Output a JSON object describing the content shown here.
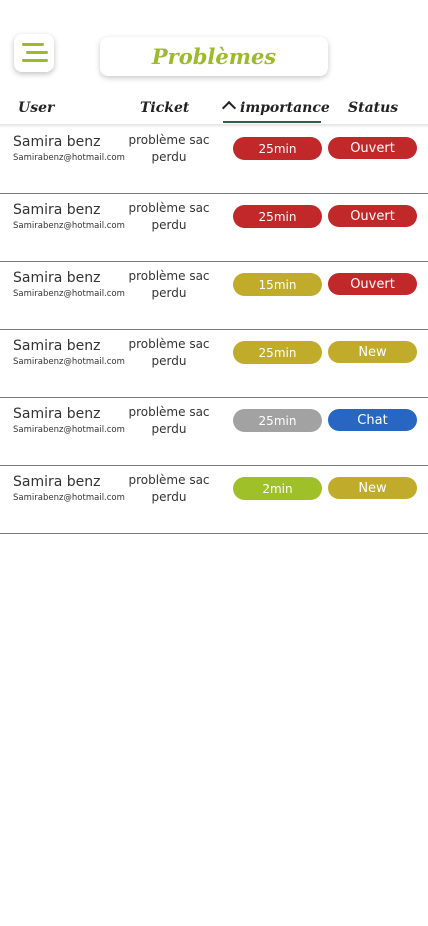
{
  "header": {
    "title": "Problèmes"
  },
  "columns": {
    "user": "User",
    "ticket": "Ticket",
    "importance": "importance",
    "status": "Status"
  },
  "colors": {
    "accent": "#9cbb2a",
    "red": "#c0282a",
    "olive": "#c0ac2a",
    "gray": "#a2a2a2",
    "blue": "#2767c3",
    "lime": "#a0c02a"
  },
  "rows": [
    {
      "name": "Samira benz",
      "email": "Samirabenz@hotmail.com",
      "ticket": "problème sac perdu",
      "importance": "25min",
      "importance_color": "#c0282a",
      "status": "Ouvert",
      "status_color": "#c0282a"
    },
    {
      "name": "Samira benz",
      "email": "Samirabenz@hotmail.com",
      "ticket": "problème sac perdu",
      "importance": "25min",
      "importance_color": "#c0282a",
      "status": "Ouvert",
      "status_color": "#c0282a"
    },
    {
      "name": "Samira benz",
      "email": "Samirabenz@hotmail.com",
      "ticket": "problème sac perdu",
      "importance": "15min",
      "importance_color": "#c0ac2a",
      "status": "Ouvert",
      "status_color": "#c0282a"
    },
    {
      "name": "Samira benz",
      "email": "Samirabenz@hotmail.com",
      "ticket": "problème sac perdu",
      "importance": "25min",
      "importance_color": "#c0ac2a",
      "status": "New",
      "status_color": "#c0ac2a"
    },
    {
      "name": "Samira benz",
      "email": "Samirabenz@hotmail.com",
      "ticket": "problème sac perdu",
      "importance": "25min",
      "importance_color": "#a2a2a2",
      "status": "Chat",
      "status_color": "#2767c3"
    },
    {
      "name": "Samira benz",
      "email": "Samirabenz@hotmail.com",
      "ticket": "problème sac perdu",
      "importance": "2min",
      "importance_color": "#a0c02a",
      "status": "New",
      "status_color": "#c0ac2a"
    }
  ]
}
